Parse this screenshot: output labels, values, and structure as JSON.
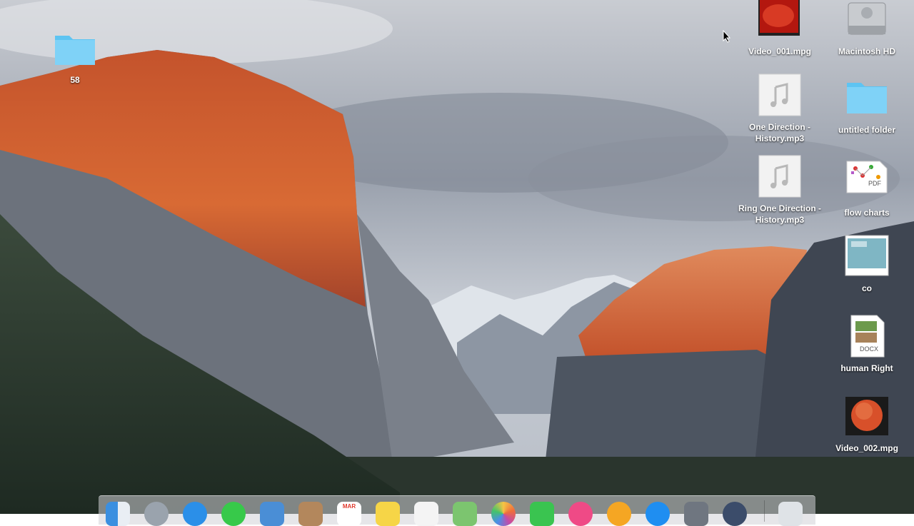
{
  "desktop": {
    "icons": [
      {
        "label": "58",
        "icon": "folder-icon"
      },
      {
        "label": "Video_001.mpg",
        "icon": "video-file-icon"
      },
      {
        "label": "Macintosh HD",
        "icon": "hard-drive-icon"
      },
      {
        "label": "One Direction - History.mp3",
        "icon": "audio-file-icon"
      },
      {
        "label": "untitled folder",
        "icon": "folder-icon"
      },
      {
        "label": "Ring One Direction - History.mp3",
        "icon": "audio-file-icon"
      },
      {
        "label": "flow charts",
        "icon": "pdf-file-icon"
      },
      {
        "label": "co",
        "icon": "image-file-icon"
      },
      {
        "label": "human Right",
        "icon": "document-file-icon"
      },
      {
        "label": "Video_002.mpg",
        "icon": "video-file-icon"
      }
    ],
    "pdf_badge": "PDF",
    "docx_badge": "DOCX"
  },
  "dock": {
    "calendar_month": "MAR",
    "items": [
      "finder-icon",
      "launchpad-icon",
      "safari-icon",
      "messages-icon",
      "mail-icon",
      "contacts-icon",
      "calendar-icon",
      "notes-icon",
      "reminders-icon",
      "maps-icon",
      "photos-icon",
      "facetime-icon",
      "itunes-icon",
      "ibooks-icon",
      "app-store-icon",
      "system-preferences-icon",
      "quicktime-icon",
      "trash-icon"
    ]
  },
  "colors": {
    "folder": "#5ec4f2",
    "dock_bg": "#d2d2d7",
    "mountain_glow": "#d4622e"
  }
}
